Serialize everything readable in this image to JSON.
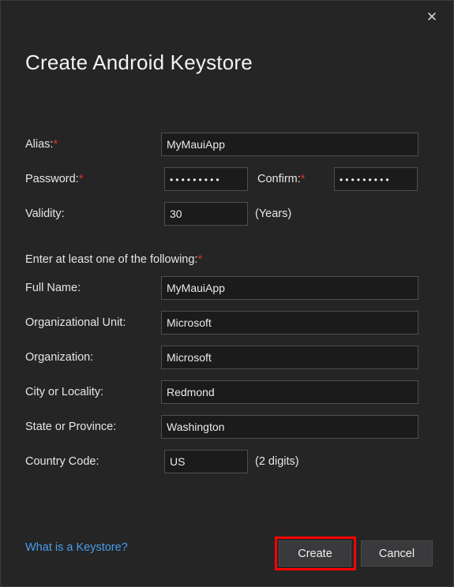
{
  "window": {
    "title": "Create Android Keystore",
    "close_icon": "close-icon",
    "close_glyph": "✕"
  },
  "colors": {
    "background": "#252526",
    "input_background": "#1b1b1b",
    "input_border": "#4f4f50",
    "text": "#e8e8e8",
    "required_asterisk": "#e03030",
    "link": "#4a9eeb",
    "button_face": "#3a3a3c",
    "highlight": "#ff0000"
  },
  "form": {
    "alias": {
      "label": "Alias:",
      "required_mark": "*",
      "value": "MyMauiApp",
      "placeholder": ""
    },
    "password": {
      "label": "Password:",
      "required_mark": "*",
      "value": "•••••••••",
      "char_count": 9
    },
    "confirm": {
      "label": "Confirm:",
      "required_mark": "*",
      "value": "•••••••••",
      "char_count": 9
    },
    "validity": {
      "label": "Validity:",
      "value": "30",
      "suffix": "(Years)"
    },
    "section_note": "Enter at least one of the following:",
    "section_note_mark": "*",
    "full_name": {
      "label": "Full Name:",
      "value": "MyMauiApp"
    },
    "organizational_unit": {
      "label": "Organizational Unit:",
      "value": "Microsoft"
    },
    "organization": {
      "label": "Organization:",
      "value": "Microsoft"
    },
    "city": {
      "label": "City or Locality:",
      "value": "Redmond"
    },
    "state": {
      "label": "State or Province:",
      "value": "Washington"
    },
    "country_code": {
      "label": "Country Code:",
      "value": "US",
      "suffix": "(2 digits)"
    }
  },
  "footer": {
    "help_link": "What is a Keystore?",
    "create_label": "Create",
    "cancel_label": "Cancel"
  }
}
